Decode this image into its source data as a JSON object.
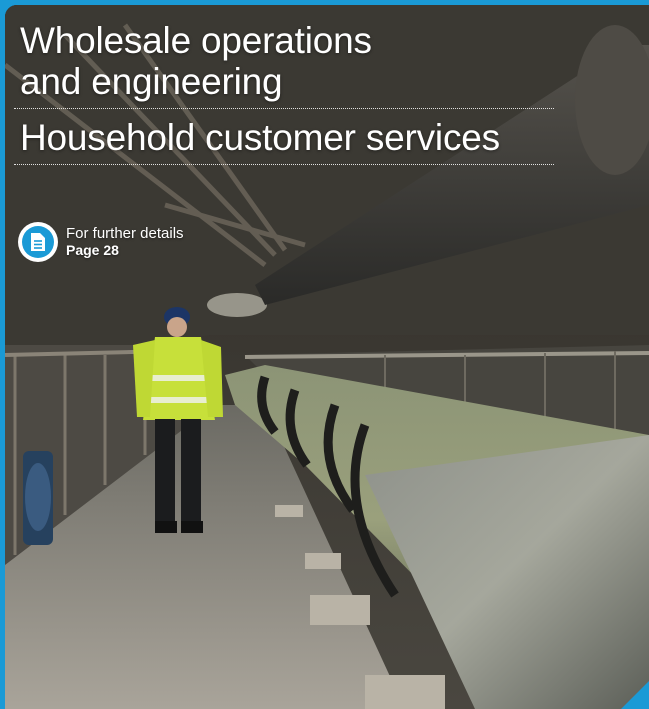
{
  "heading": {
    "line1": "Wholesale operations",
    "line2": "and engineering",
    "line3": "Household customer services"
  },
  "reference": {
    "icon": "document-icon",
    "label": "For further details",
    "page": "Page 28"
  },
  "colors": {
    "accent": "#1a9ad6",
    "text": "#ffffff"
  }
}
